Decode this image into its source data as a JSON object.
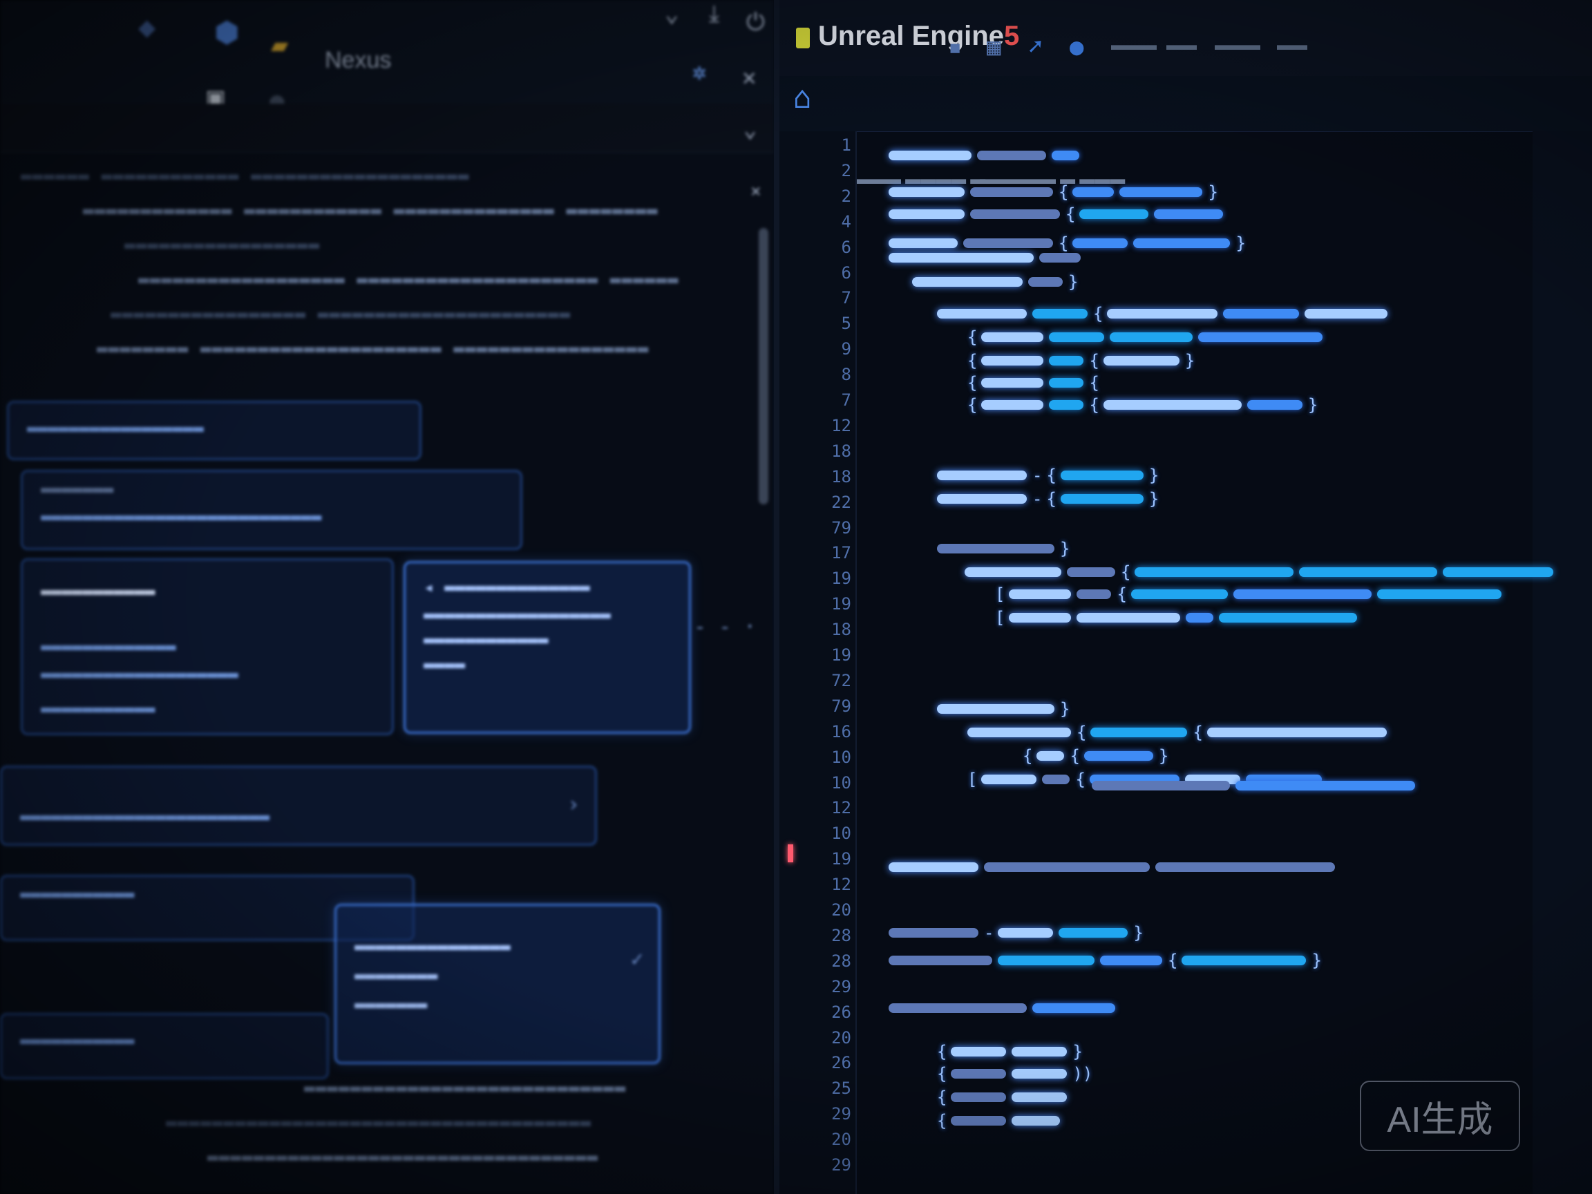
{
  "window": {
    "app_title": "Unreal Engine",
    "app_title_suffix": "5"
  },
  "left_panel": {
    "header_label": "Nexus",
    "close_glyph": "✕",
    "pin_glyph": "✲",
    "collapse_glyph": "⌄",
    "panel_close_glyph": "×"
  },
  "editor": {
    "line_numbers": [
      "1",
      "2",
      "2",
      "4",
      "6",
      "6",
      "7",
      "5",
      "9",
      "8",
      "7",
      "12",
      "18",
      "18",
      "22",
      "79",
      "17",
      "19",
      "19",
      "18",
      "19",
      "72",
      "79",
      "16",
      "10",
      "10",
      "12",
      "10",
      "19",
      "12",
      "20",
      "28",
      "28",
      "29",
      "26",
      "20",
      "26",
      "25",
      "29",
      "20",
      "29"
    ]
  },
  "colors": {
    "accent": "#3f8bf5",
    "glow": "#a6cdff",
    "background": "#060b15",
    "brand_yellow": "#d8dc3a",
    "brand_red": "#ff5a5a"
  },
  "icons": {
    "home": "home-icon",
    "save": "save-icon",
    "close": "close-icon"
  },
  "watermark": {
    "text": "AI生成"
  }
}
